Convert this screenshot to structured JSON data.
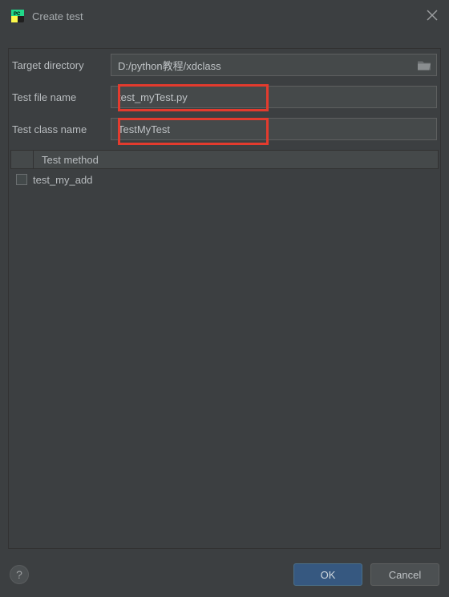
{
  "window": {
    "title": "Create test"
  },
  "form": {
    "targetDirectory": {
      "label": "Target directory",
      "value": "D:/python教程/xdclass"
    },
    "testFileName": {
      "label": "Test file name",
      "value": "test_myTest.py"
    },
    "testClassName": {
      "label": "Test class name",
      "value": "TestMyTest"
    }
  },
  "methodList": {
    "header": "Test method",
    "rows": [
      {
        "name": "test_my_add",
        "checked": false
      }
    ]
  },
  "buttons": {
    "ok": "OK",
    "cancel": "Cancel",
    "help": "?"
  }
}
